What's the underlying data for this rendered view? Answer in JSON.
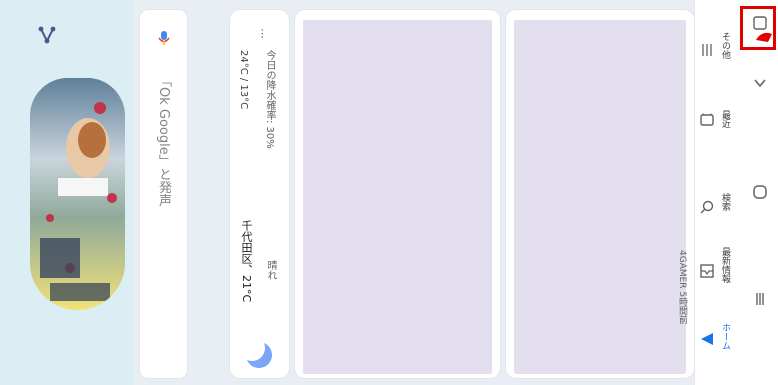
{
  "search": {
    "hint": "「Ok Google」と発声"
  },
  "weather": {
    "location": "千代田区、21°C",
    "condition": "晴れ",
    "temps": "24°C / 13°C",
    "rain": "今日の降水確率: 30%"
  },
  "nav": {
    "items": [
      {
        "label": "ホーム",
        "active": true
      },
      {
        "label": "最新情報"
      },
      {
        "label": "検索"
      },
      {
        "label": "最近"
      },
      {
        "label": "その他"
      }
    ],
    "partial_text": "4GAMER 5時間前"
  },
  "colors": {
    "accent": "#1a73e8",
    "highlight": "#e00000",
    "placeholder": "#e3dfee"
  }
}
